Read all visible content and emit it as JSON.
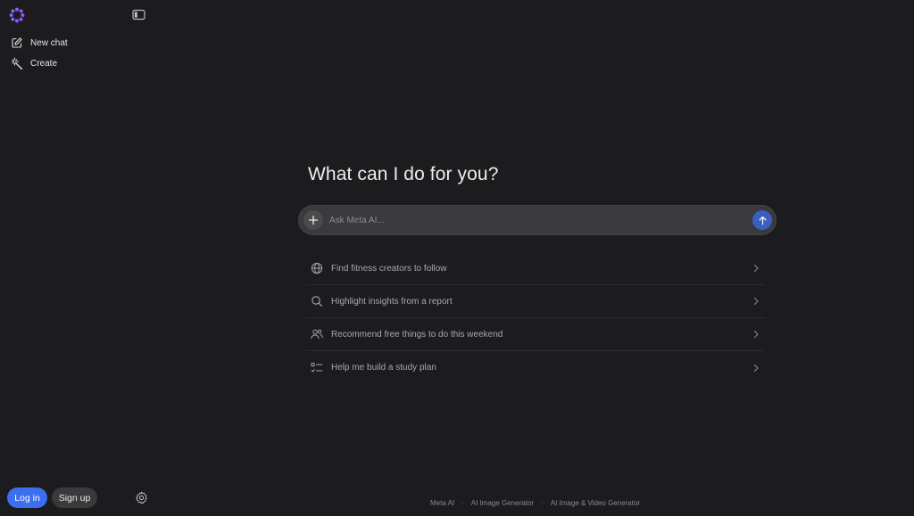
{
  "sidebar": {
    "new_chat": "New chat",
    "create": "Create",
    "login": "Log in",
    "signup": "Sign up"
  },
  "main": {
    "headline": "What can I do for you?",
    "composer_placeholder": "Ask Meta AI...",
    "suggestions": [
      {
        "icon": "globe-icon",
        "label": "Find fitness creators to follow"
      },
      {
        "icon": "search-icon",
        "label": "Highlight insights from a report"
      },
      {
        "icon": "people-icon",
        "label": "Recommend free things to do this weekend"
      },
      {
        "icon": "checklist-icon",
        "label": "Help me build a study plan"
      }
    ]
  },
  "footer": {
    "links": [
      "Meta AI",
      "AI Image Generator",
      "AI Image & Video Generator"
    ]
  },
  "colors": {
    "background": "#1c1b1d",
    "accent_blue": "#3b6ff0",
    "logo_purple": "#8b5cf6"
  }
}
